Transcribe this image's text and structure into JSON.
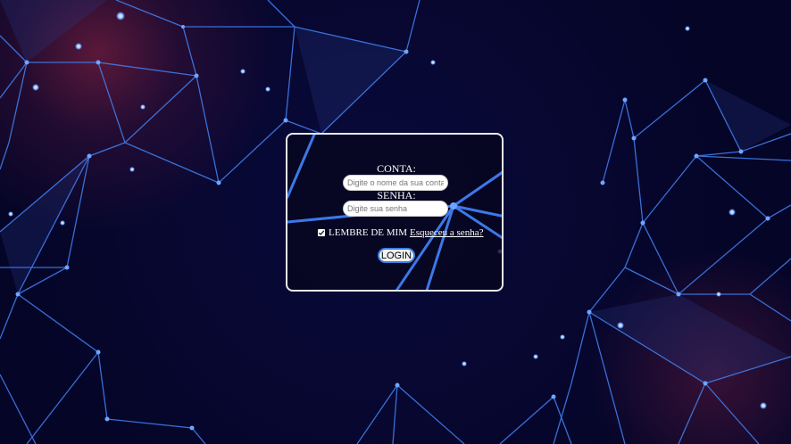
{
  "login": {
    "account_label": "CONTA:",
    "account_placeholder": "Digite o nome da sua conta",
    "password_label": "SENHA:",
    "password_placeholder": "Digite sua senha",
    "remember_label": "LEMBRE DE MIM",
    "remember_checked": true,
    "forgot_link": "Esqueceu a senha?",
    "login_button": "LOGIN"
  },
  "theme": {
    "background": "#05052a",
    "network_line": "#3f7be8",
    "card_border": "#e8e8f0"
  }
}
